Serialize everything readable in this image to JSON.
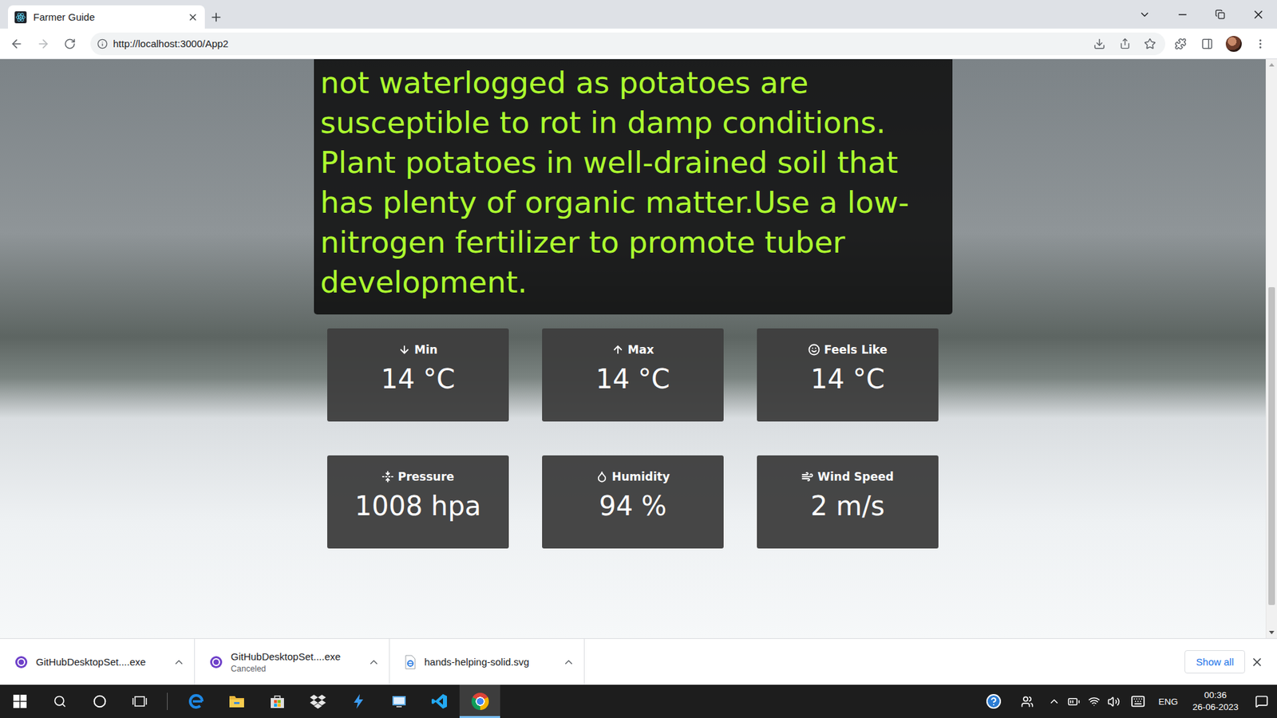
{
  "browser": {
    "tabs": [
      {
        "label": "Farmer Guide",
        "selected": true
      }
    ],
    "url": "http://localhost:3000/App2"
  },
  "guide": {
    "text": "not waterlogged as potatoes are susceptible to rot in damp conditions. Plant potatoes in well-drained soil that has plenty of organic matter.Use a low-nitrogen fertilizer to promote tuber development."
  },
  "weather": [
    {
      "kind": "min",
      "label": "Min",
      "value": "14 °C"
    },
    {
      "kind": "max",
      "label": "Max",
      "value": "14 °C"
    },
    {
      "kind": "feels",
      "label": "Feels Like",
      "value": "14 °C"
    },
    {
      "kind": "pressure",
      "label": "Pressure",
      "value": "1008 hpa"
    },
    {
      "kind": "humidity",
      "label": "Humidity",
      "value": "94 %"
    },
    {
      "kind": "wind",
      "label": "Wind Speed",
      "value": "2 m/s"
    }
  ],
  "scrollbar": {
    "offset": 0.39,
    "level": 0.57
  },
  "downloads": {
    "items": [
      {
        "kind": "github",
        "name": "GitHubDesktopSet....exe"
      },
      {
        "kind": "github",
        "name": "GitHubDesktopSet....exe",
        "status": "Canceled"
      },
      {
        "kind": "svg",
        "name": "hands-helping-solid.svg"
      }
    ],
    "show_all": "Show all"
  },
  "taskbar": {
    "apps": [
      {
        "kind": "edge",
        "active": false
      },
      {
        "kind": "explorer",
        "active": false
      },
      {
        "kind": "store",
        "active": false
      },
      {
        "kind": "dropbox",
        "active": false
      },
      {
        "kind": "lightning",
        "active": false
      },
      {
        "kind": "installer",
        "active": false
      },
      {
        "kind": "vscode",
        "active": false
      },
      {
        "kind": "chrome",
        "active": true
      }
    ],
    "language": "ENG",
    "time": "00:36",
    "date": "26-06-2023"
  }
}
